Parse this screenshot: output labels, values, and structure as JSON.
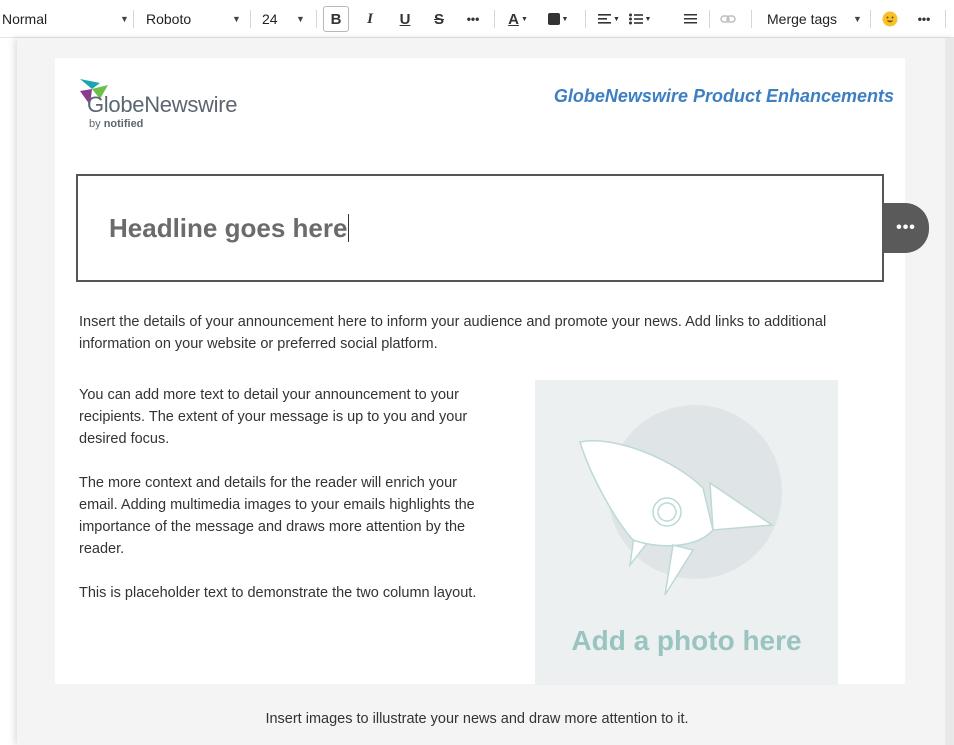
{
  "toolbar": {
    "style_value": "Normal",
    "font_value": "Roboto",
    "size_value": "24",
    "bold_label": "B",
    "italic_label": "I",
    "underline_label": "U",
    "strike_label": "S",
    "more_label": "•••",
    "text_color_label": "A",
    "merge_tags_label": "Merge tags",
    "more_end_label": "•••"
  },
  "header": {
    "logo_name": "GlobeNewswire",
    "logo_sub_prefix": "by ",
    "logo_sub_brand": "notified",
    "title": "GlobeNewswire Product Enhancements"
  },
  "headline": {
    "text": "Headline goes here",
    "more_label": "•••"
  },
  "body": {
    "intro": "Insert the details of your announcement here to inform your audience and promote your news. Add links to additional information on your website or preferred social platform.",
    "paragraph_1": "You can add more text to detail your announcement to your recipients. The extent of your message is up to you and your desired focus.",
    "paragraph_2": "The more context and details for the reader will enrich your email. Adding multimedia images to your emails highlights the importance of the message and draws more attention by the reader.",
    "paragraph_3": "This is placeholder text to demonstrate the two column layout."
  },
  "photo": {
    "label": "Add a photo here"
  },
  "footer": {
    "text": "Insert images to illustrate your news and draw more attention to it."
  },
  "colors": {
    "header_title": "#3d7fc1",
    "photo_label": "#9ac4c0",
    "logo_green": "#6cc04a",
    "logo_purple": "#8b3a8f",
    "logo_teal": "#1aa7b0"
  }
}
